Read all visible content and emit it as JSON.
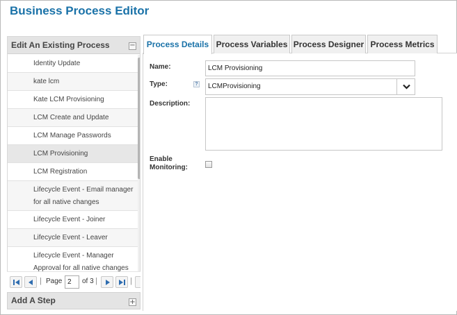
{
  "app": {
    "title": "Business Process Editor"
  },
  "left_panel": {
    "header": "Edit An Existing Process",
    "collapse_symbol": "−",
    "items": [
      {
        "label": "Identity Update"
      },
      {
        "label": "kate lcm"
      },
      {
        "label": "Kate LCM Provisioning"
      },
      {
        "label": "LCM Create and Update"
      },
      {
        "label": "LCM Manage Passwords"
      },
      {
        "label": "LCM Provisioning",
        "selected": true
      },
      {
        "label": "LCM Registration"
      },
      {
        "label": "Lifecycle Event - Email manager for all native changes"
      },
      {
        "label": "Lifecycle Event - Joiner"
      },
      {
        "label": "Lifecycle Event - Leaver"
      },
      {
        "label": "Lifecycle Event - Manager Approval for all native changes"
      }
    ],
    "pager": {
      "page_label": "Page",
      "page_value": "2",
      "of_label": "of 3"
    }
  },
  "add_step": {
    "header": "Add A Step",
    "expand_symbol": "+"
  },
  "tabs": [
    {
      "label": "Process Details",
      "active": true
    },
    {
      "label": "Process Variables"
    },
    {
      "label": "Process Designer"
    },
    {
      "label": "Process Metrics"
    }
  ],
  "form": {
    "name_label": "Name:",
    "name_value": "LCM Provisioning",
    "type_label": "Type:",
    "type_value": "LCMProvisioning",
    "help_symbol": "?",
    "description_label": "Description:",
    "enable_label_line1": "Enable",
    "enable_label_line2": "Monitoring:"
  },
  "colors": {
    "accent": "#1a72a8",
    "panel_header_bg": "#e4e4e4",
    "selected_row": "#e7e7e7"
  }
}
